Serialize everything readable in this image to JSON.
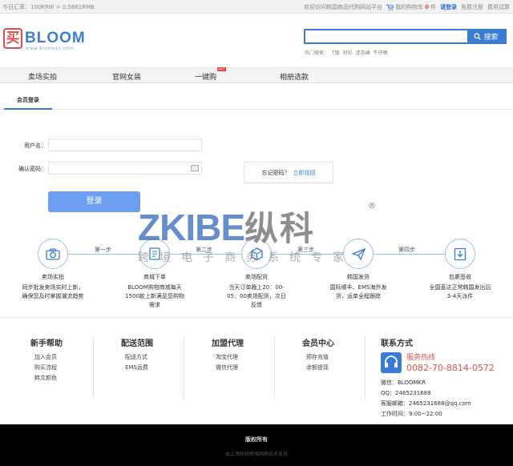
{
  "topbar": {
    "rate": "今日汇率：100KRW = 0.5661RMB",
    "welcome": "欢迎访问韩国商品代购网站平台",
    "cart_label": "我的购物车",
    "cart_count": "0",
    "cart_unit": "件",
    "login": "请登录",
    "register": "免费注册",
    "trial": "费用试算"
  },
  "header": {
    "logo_mark": "买",
    "logo_text": "BLOOM",
    "logo_url": "www.bloomkr.com",
    "search_placeholder": "",
    "search_button": "搜索",
    "hot_label": "热门搜索：",
    "hot_keywords": [
      "T恤",
      "衬衫",
      "连衣裙",
      "牛仔裤"
    ]
  },
  "nav": {
    "items": [
      "卖场实拍",
      "官网女装",
      "一键购",
      "相册选款"
    ],
    "badge": "HOT"
  },
  "login": {
    "tab": "会员登录",
    "username_label": "用户名：",
    "password_label": "确认密码：",
    "submit": "登录",
    "forgot_text": "忘记密码？",
    "forgot_link": "立即找回"
  },
  "watermark": {
    "brand": "ZKIBE",
    "brand_cn": "纵科",
    "reg": "®",
    "sub": "跨境电子商务系统专家"
  },
  "steps": {
    "labels": [
      "第一步",
      "第二步",
      "第三步",
      "第四步"
    ],
    "items": [
      {
        "title": "卖场实拍",
        "desc": "同步批发卖场实时上新，确保您及时掌握潮流趋势"
      },
      {
        "title": "商城下单",
        "desc": "BLOOM购物商城每天1500款上新满足您购物需求"
      },
      {
        "title": "卖场配货",
        "desc": "当天订单晚上20：00-05：00卖场配货，次日反馈"
      },
      {
        "title": "韩国发货",
        "desc": "国际顺丰、EMS海外发货，运单全程跟踪"
      },
      {
        "title": "包裹签收",
        "desc": "全国直达正常韩国发出后3-4天派件"
      }
    ]
  },
  "footer": {
    "columns": [
      {
        "title": "新手帮助",
        "links": [
          "加入会员",
          "购买流程",
          "韩文颜色"
        ]
      },
      {
        "title": "配送范围",
        "links": [
          "配送方式",
          "EMS运费"
        ]
      },
      {
        "title": "加盟代理",
        "links": [
          "淘宝代理",
          "微信代理"
        ]
      },
      {
        "title": "会员中心",
        "links": [
          "预存充值",
          "余额提现"
        ]
      }
    ],
    "contact": {
      "title": "联系方式",
      "hotline_label": "服务热线",
      "hotline": "0082-70-8814-0572",
      "wechat": "微信：BLOOMKR",
      "qq": "QQ：2465231688",
      "email": "客服邮箱：2465231688@qq.com",
      "hours": "工作时间：9:00~22:00"
    },
    "copyright": "版权所有",
    "powered": "由上海纵科跨境网络技术支持"
  }
}
